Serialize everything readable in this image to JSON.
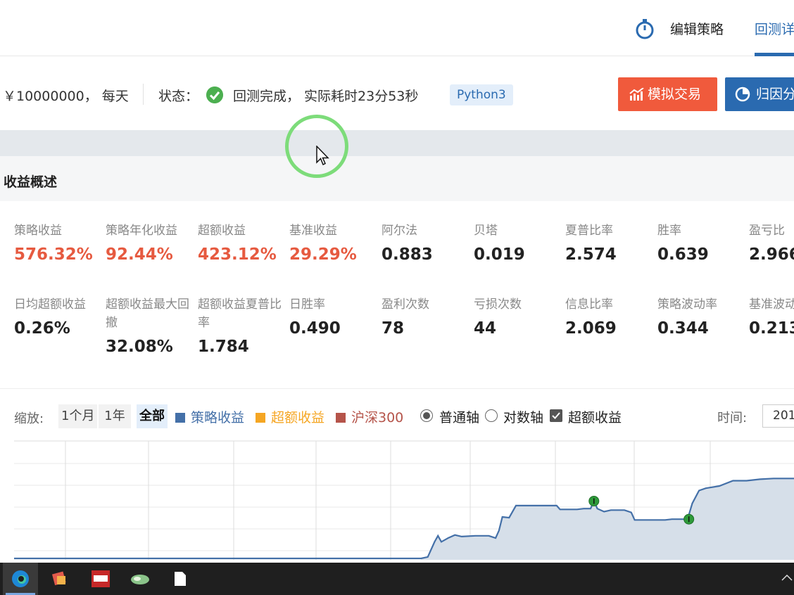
{
  "header": {
    "tabs": [
      {
        "label": "编辑策略"
      },
      {
        "label": "回测详"
      }
    ]
  },
  "status": {
    "capital_text": "￥10000000， 每天",
    "label": "状态：",
    "text": "回测完成， 实际耗时23分53秒",
    "badge": "Python3",
    "sim_button": "模拟交易",
    "attr_button": "归因分"
  },
  "section": {
    "title": "收益概述"
  },
  "metrics": {
    "row1": [
      {
        "label": "策略收益",
        "value": "576.32%",
        "color": "#e65a40"
      },
      {
        "label": "策略年化收益",
        "value": "92.44%",
        "color": "#e65a40"
      },
      {
        "label": "超额收益",
        "value": "423.12%",
        "color": "#e65a40"
      },
      {
        "label": "基准收益",
        "value": "29.29%",
        "color": "#e65a40"
      },
      {
        "label": "阿尔法",
        "value": "0.883"
      },
      {
        "label": "贝塔",
        "value": "0.019"
      },
      {
        "label": "夏普比率",
        "value": "2.574"
      },
      {
        "label": "胜率",
        "value": "0.639"
      },
      {
        "label": "盈亏比",
        "value": "2.966"
      }
    ],
    "row2": [
      {
        "label": "日均超额收益",
        "value": "0.26%"
      },
      {
        "label": "超额收益最大回撤",
        "value": "32.08%"
      },
      {
        "label": "超额收益夏普比率",
        "value": "1.784"
      },
      {
        "label": "日胜率",
        "value": "0.490"
      },
      {
        "label": "盈利次数",
        "value": "78"
      },
      {
        "label": "亏损次数",
        "value": "44"
      },
      {
        "label": "信息比率",
        "value": "2.069"
      },
      {
        "label": "策略波动率",
        "value": "0.344"
      },
      {
        "label": "基准波动",
        "value": "0.213"
      }
    ]
  },
  "chart_toolbar": {
    "zoom_label": "缩放:",
    "zoom_buttons": [
      "1个月",
      "1年",
      "全部"
    ],
    "legend": [
      {
        "label": "策略收益",
        "color": "#4470a8"
      },
      {
        "label": "超额收益",
        "color": "#f5a623"
      },
      {
        "label": "沪深300",
        "color": "#b5544a"
      }
    ],
    "axis_options": {
      "normal": "普通轴",
      "log": "对数轴",
      "excess": "超额收益"
    },
    "time_label": "时间:",
    "time_value": "201"
  },
  "chart_data": {
    "type": "area",
    "title": "",
    "xlabel": "",
    "ylabel": "",
    "series": [
      {
        "name": "策略收益",
        "color": "#4470a8",
        "points": [
          [
            0.0,
            0.0
          ],
          [
            0.6,
            0.0
          ],
          [
            0.61,
            0.02
          ],
          [
            0.62,
            0.22
          ],
          [
            0.625,
            0.3
          ],
          [
            0.63,
            0.22
          ],
          [
            0.64,
            0.27
          ],
          [
            0.65,
            0.31
          ],
          [
            0.66,
            0.29
          ],
          [
            0.68,
            0.3
          ],
          [
            0.7,
            0.3
          ],
          [
            0.71,
            0.27
          ],
          [
            0.715,
            0.37
          ],
          [
            0.72,
            0.55
          ],
          [
            0.73,
            0.54
          ],
          [
            0.74,
            0.7
          ],
          [
            0.75,
            0.7
          ],
          [
            0.8,
            0.7
          ],
          [
            0.805,
            0.65
          ],
          [
            0.83,
            0.65
          ],
          [
            0.84,
            0.66
          ],
          [
            0.85,
            0.66
          ],
          [
            0.855,
            0.76
          ],
          [
            0.86,
            0.66
          ],
          [
            0.87,
            0.62
          ],
          [
            0.88,
            0.64
          ],
          [
            0.9,
            0.64
          ],
          [
            0.91,
            0.61
          ],
          [
            0.915,
            0.51
          ],
          [
            0.96,
            0.51
          ],
          [
            0.97,
            0.52
          ],
          [
            0.98,
            0.52
          ],
          [
            0.99,
            0.52
          ],
          [
            0.995,
            0.58
          ],
          [
            1.0,
            0.73
          ],
          [
            1.01,
            0.9
          ],
          [
            1.02,
            0.93
          ],
          [
            1.04,
            0.96
          ],
          [
            1.06,
            1.03
          ],
          [
            1.08,
            1.03
          ],
          [
            1.1,
            1.05
          ],
          [
            1.12,
            1.06
          ],
          [
            1.15,
            1.06
          ]
        ]
      }
    ],
    "markers": [
      [
        0.855,
        0.76
      ],
      [
        0.995,
        0.52
      ]
    ],
    "grid": true
  }
}
